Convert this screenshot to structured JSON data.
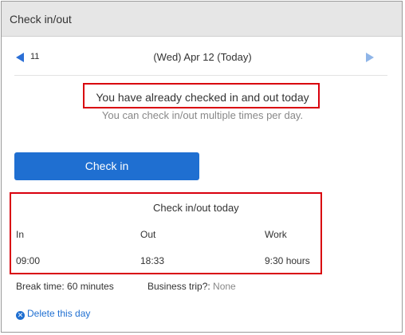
{
  "header": {
    "title": "Check in/out"
  },
  "nav": {
    "prev_label": "11",
    "date_label": "(Wed) Apr 12 (Today)"
  },
  "message": {
    "main": "You have already checked in and out today",
    "sub": "You can check in/out multiple times per day."
  },
  "check_button": {
    "label": "Check in"
  },
  "today": {
    "title": "Check in/out today",
    "columns": [
      {
        "header": "In",
        "value": "09:00"
      },
      {
        "header": "Out",
        "value": "18:33"
      },
      {
        "header": "Work",
        "value": "9:30 hours"
      }
    ]
  },
  "footer": {
    "break_label": "Break time:",
    "break_value": "60 minutes",
    "trip_label": "Business trip?:",
    "trip_value": "None",
    "delete_label": "Delete this day"
  },
  "colors": {
    "accent": "#1f6fd1",
    "highlight": "#d9000d"
  }
}
